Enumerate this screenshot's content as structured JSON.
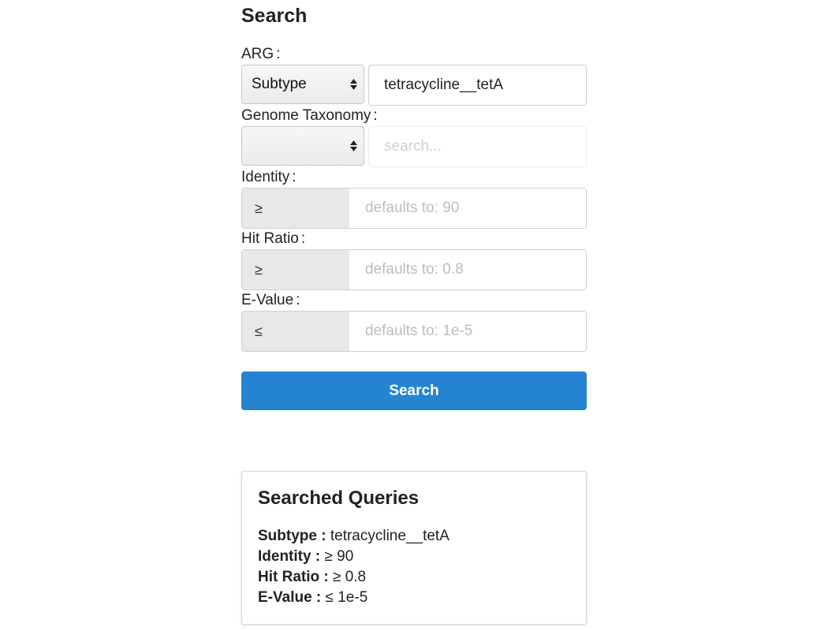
{
  "page": {
    "title": "Search"
  },
  "form": {
    "arg": {
      "label": "ARG",
      "colon": ":",
      "select_value": "Subtype",
      "input_value": "tetracycline__tetA"
    },
    "taxonomy": {
      "label": "Genome Taxonomy",
      "colon": ":",
      "select_value": "",
      "input_placeholder": "search..."
    },
    "identity": {
      "label": "Identity",
      "colon": ":",
      "operator": "≥",
      "placeholder": "defaults to: 90"
    },
    "hit_ratio": {
      "label": "Hit Ratio",
      "colon": ":",
      "operator": "≥",
      "placeholder": "defaults to: 0.8"
    },
    "evalue": {
      "label": "E-Value",
      "colon": ":",
      "operator": "≤",
      "placeholder": "defaults to: 1e-5"
    },
    "submit_label": "Search",
    "accent_color": "#2484d2"
  },
  "queries": {
    "title": "Searched Queries",
    "items": [
      {
        "key": "Subtype :",
        "value": "tetracycline__tetA"
      },
      {
        "key": "Identity :",
        "value": "≥ 90"
      },
      {
        "key": "Hit Ratio :",
        "value": "≥ 0.8"
      },
      {
        "key": "E-Value :",
        "value": "≤ 1e-5"
      }
    ]
  }
}
